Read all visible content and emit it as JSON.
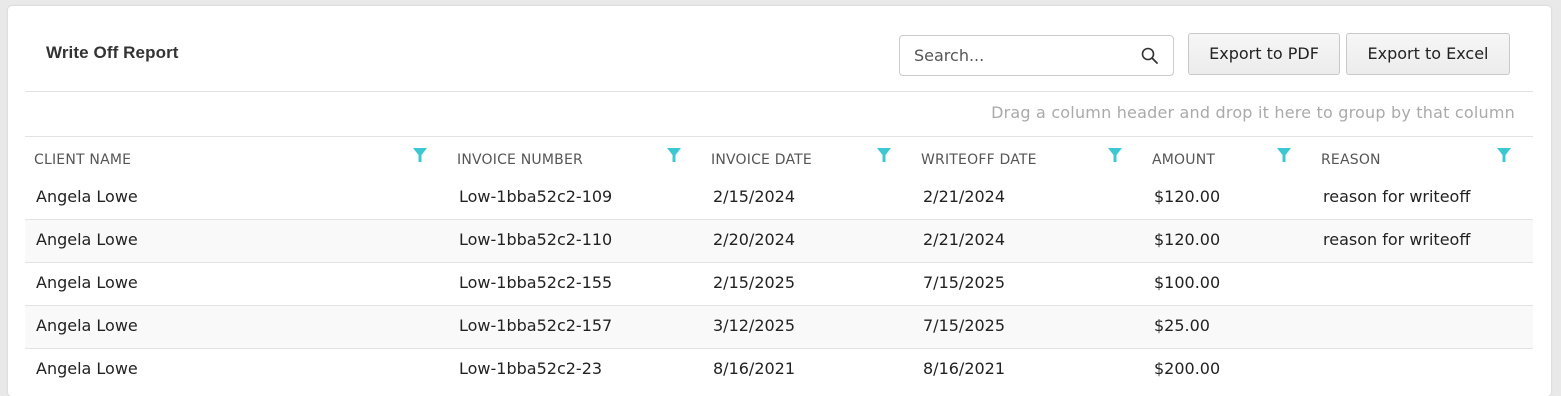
{
  "report": {
    "title": "Write Off Report",
    "search_placeholder": "Search...",
    "export_pdf_label": "Export to PDF",
    "export_excel_label": "Export to Excel",
    "group_hint": "Drag a column header and drop it here to group by that column"
  },
  "columns": [
    "CLIENT NAME",
    "INVOICE NUMBER",
    "INVOICE DATE",
    "WRITEOFF DATE",
    "AMOUNT",
    "REASON"
  ],
  "rows": [
    [
      "Angela Lowe",
      "Low-1bba52c2-109",
      "2/15/2024",
      "2/21/2024",
      "$120.00",
      "reason for writeoff"
    ],
    [
      "Angela Lowe",
      "Low-1bba52c2-110",
      "2/20/2024",
      "2/21/2024",
      "$120.00",
      "reason for writeoff"
    ],
    [
      "Angela Lowe",
      "Low-1bba52c2-155",
      "2/15/2025",
      "7/15/2025",
      "$100.00",
      ""
    ],
    [
      "Angela Lowe",
      "Low-1bba52c2-157",
      "3/12/2025",
      "7/15/2025",
      "$25.00",
      ""
    ],
    [
      "Angela Lowe",
      "Low-1bba52c2-23",
      "8/16/2021",
      "8/16/2021",
      "$200.00",
      ""
    ]
  ],
  "colors": {
    "filter_icon": "#3cc8d2",
    "accent_border": "#e3e3e3"
  }
}
